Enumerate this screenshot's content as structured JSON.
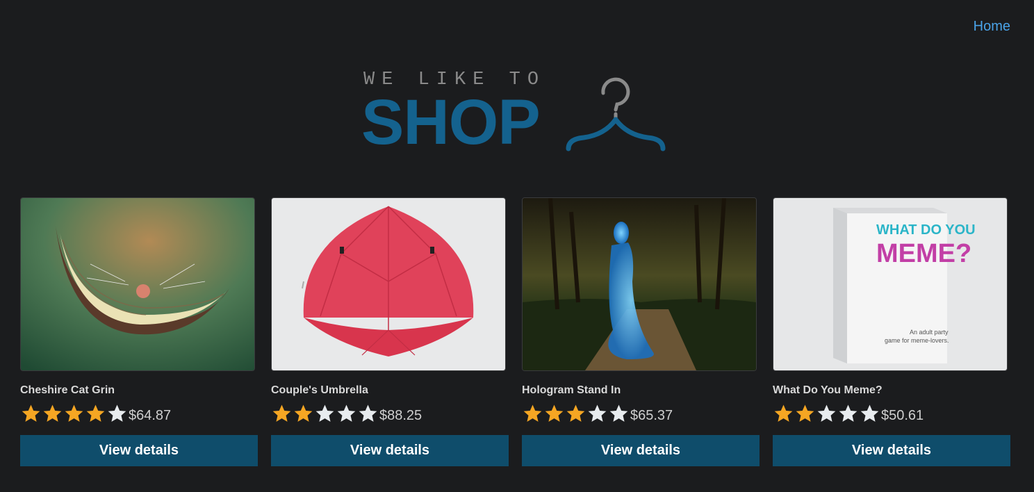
{
  "nav": {
    "home_label": "Home"
  },
  "logo": {
    "tagline": "WE LIKE TO",
    "word": "SHOP",
    "icon": "hanger-icon"
  },
  "products": [
    {
      "title": "Cheshire Cat Grin",
      "rating": 4,
      "max_rating": 5,
      "price": "$64.87",
      "button_label": "View details",
      "image": "cheshire-cat-grin-image"
    },
    {
      "title": "Couple's Umbrella",
      "rating": 2,
      "max_rating": 5,
      "price": "$88.25",
      "button_label": "View details",
      "image": "red-umbrella-image"
    },
    {
      "title": "Hologram Stand In",
      "rating": 3,
      "max_rating": 5,
      "price": "$65.37",
      "button_label": "View details",
      "image": "hologram-woman-park-image"
    },
    {
      "title": "What Do You Meme?",
      "rating": 2,
      "max_rating": 5,
      "price": "$50.61",
      "button_label": "View details",
      "image": "meme-card-game-box-image",
      "image_text": {
        "line1": "WHAT DO YOU",
        "line2": "MEME?",
        "tagline1": "An adult party",
        "tagline2": "game for meme-lovers."
      }
    }
  ],
  "colors": {
    "background": "#1b1c1e",
    "link": "#4aa3e8",
    "brand": "#14628e",
    "button": "#0f4d6b",
    "star_filled": "#f5a623",
    "star_empty": "#e8ecef"
  }
}
